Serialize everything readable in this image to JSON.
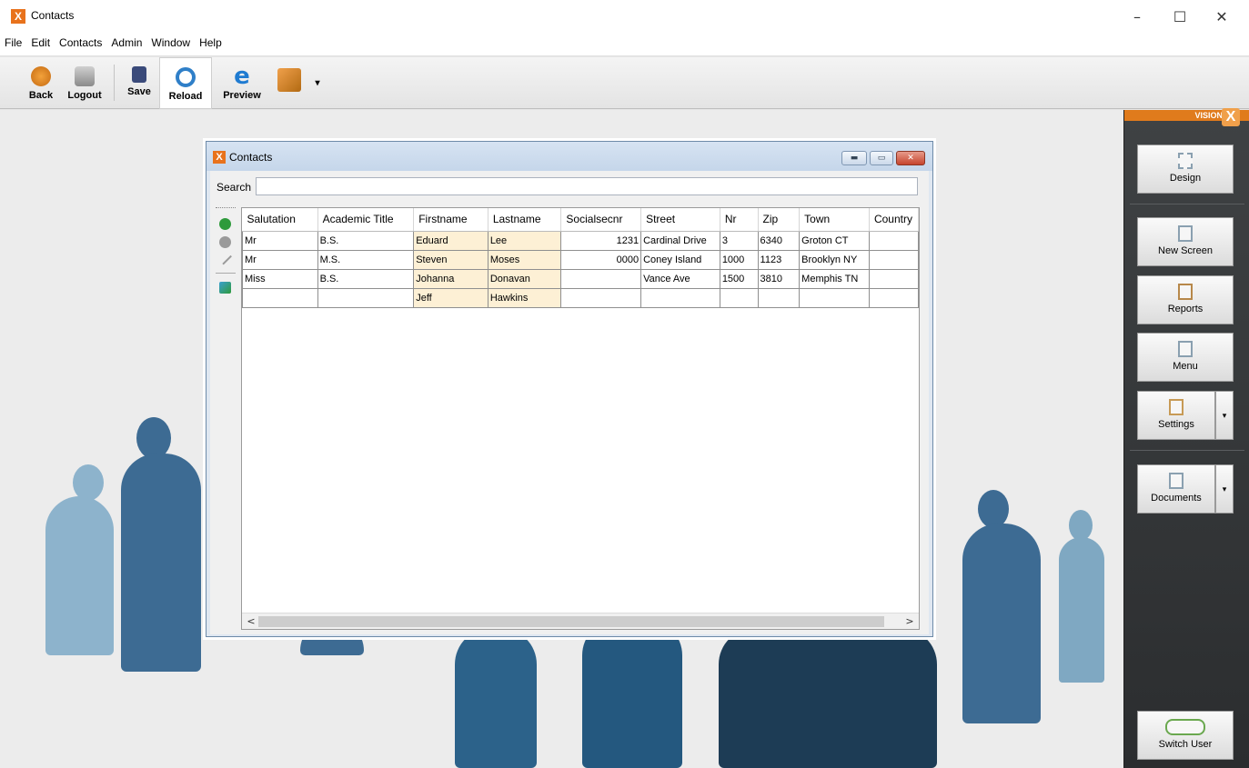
{
  "app": {
    "title": "Contacts",
    "icon": "x-logo-icon"
  },
  "window_controls": {
    "minimize": "–",
    "maximize": "☐",
    "close": "✕"
  },
  "menu": [
    "File",
    "Edit",
    "Contacts",
    "Admin",
    "Window",
    "Help"
  ],
  "toolbar": {
    "back": "Back",
    "logout": "Logout",
    "save": "Save",
    "reload": "Reload",
    "preview": "Preview",
    "more": "▾"
  },
  "right_panel": {
    "brand": "VISION",
    "brand_x": "X",
    "design": "Design",
    "new_screen": "New Screen",
    "reports": "Reports",
    "menu": "Menu",
    "settings": "Settings",
    "documents": "Documents",
    "switch_user": "Switch User",
    "drop": "▾"
  },
  "contacts_window": {
    "title": "Contacts",
    "search_label": "Search",
    "search_value": "",
    "columns": [
      "Salutation",
      "Academic Title",
      "Firstname",
      "Lastname",
      "Socialsecnr",
      "Street",
      "Nr",
      "Zip",
      "Town",
      "Country"
    ],
    "rows": [
      [
        "Mr",
        "B.S.",
        "Eduard",
        "Lee",
        "1231",
        "Cardinal Drive",
        "3",
        "6340",
        "Groton CT",
        ""
      ],
      [
        "Mr",
        "M.S.",
        "Steven",
        "Moses",
        "0000",
        "Coney Island",
        "1000",
        "1123",
        "Brooklyn NY",
        ""
      ],
      [
        "Miss",
        "B.S.",
        "Johanna",
        "Donavan",
        "",
        "Vance Ave",
        "1500",
        "3810",
        "Memphis TN",
        ""
      ],
      [
        "",
        "",
        "Jeff",
        "Hawkins",
        "",
        "",
        "",
        "",
        "",
        ""
      ]
    ],
    "scroll_left": "<",
    "scroll_right": ">"
  },
  "colors": {
    "accent": "#e07b1c",
    "panel_dark": "#2b2d2f",
    "required_cell": "#fdf0d5",
    "silhouette": "#5f8fb0"
  }
}
